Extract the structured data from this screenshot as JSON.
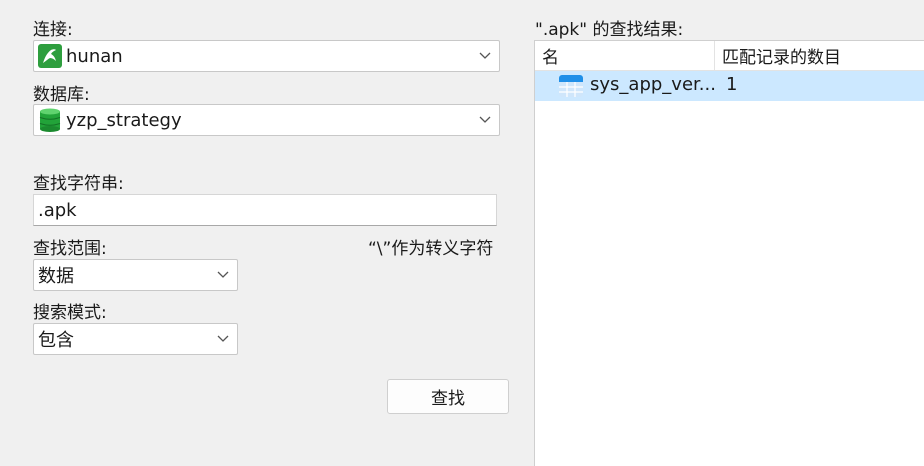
{
  "connection": {
    "label": "连接:",
    "value": "hunan",
    "icon": "mysql-dolphin-icon",
    "icon_color": "#2e9e3e"
  },
  "database": {
    "label": "数据库:",
    "value": "yzp_strategy",
    "icon": "database-icon",
    "icon_color": "#22a339"
  },
  "search": {
    "label": "查找字符串:",
    "value": ".apk"
  },
  "scope": {
    "label": "查找范围:",
    "value": "数据",
    "escape_hint": "“\\”作为转义字符"
  },
  "mode": {
    "label": "搜索模式:",
    "value": "包含"
  },
  "find_button": "查找",
  "results": {
    "title": "\".apk\" 的查找结果:",
    "columns": [
      "名",
      "匹配记录的数目"
    ],
    "rows": [
      {
        "name": "sys_app_ver...",
        "count": "1",
        "icon": "table-icon",
        "icon_color": "#1f8fe8"
      }
    ],
    "selected_row_color": "#cce8ff"
  }
}
